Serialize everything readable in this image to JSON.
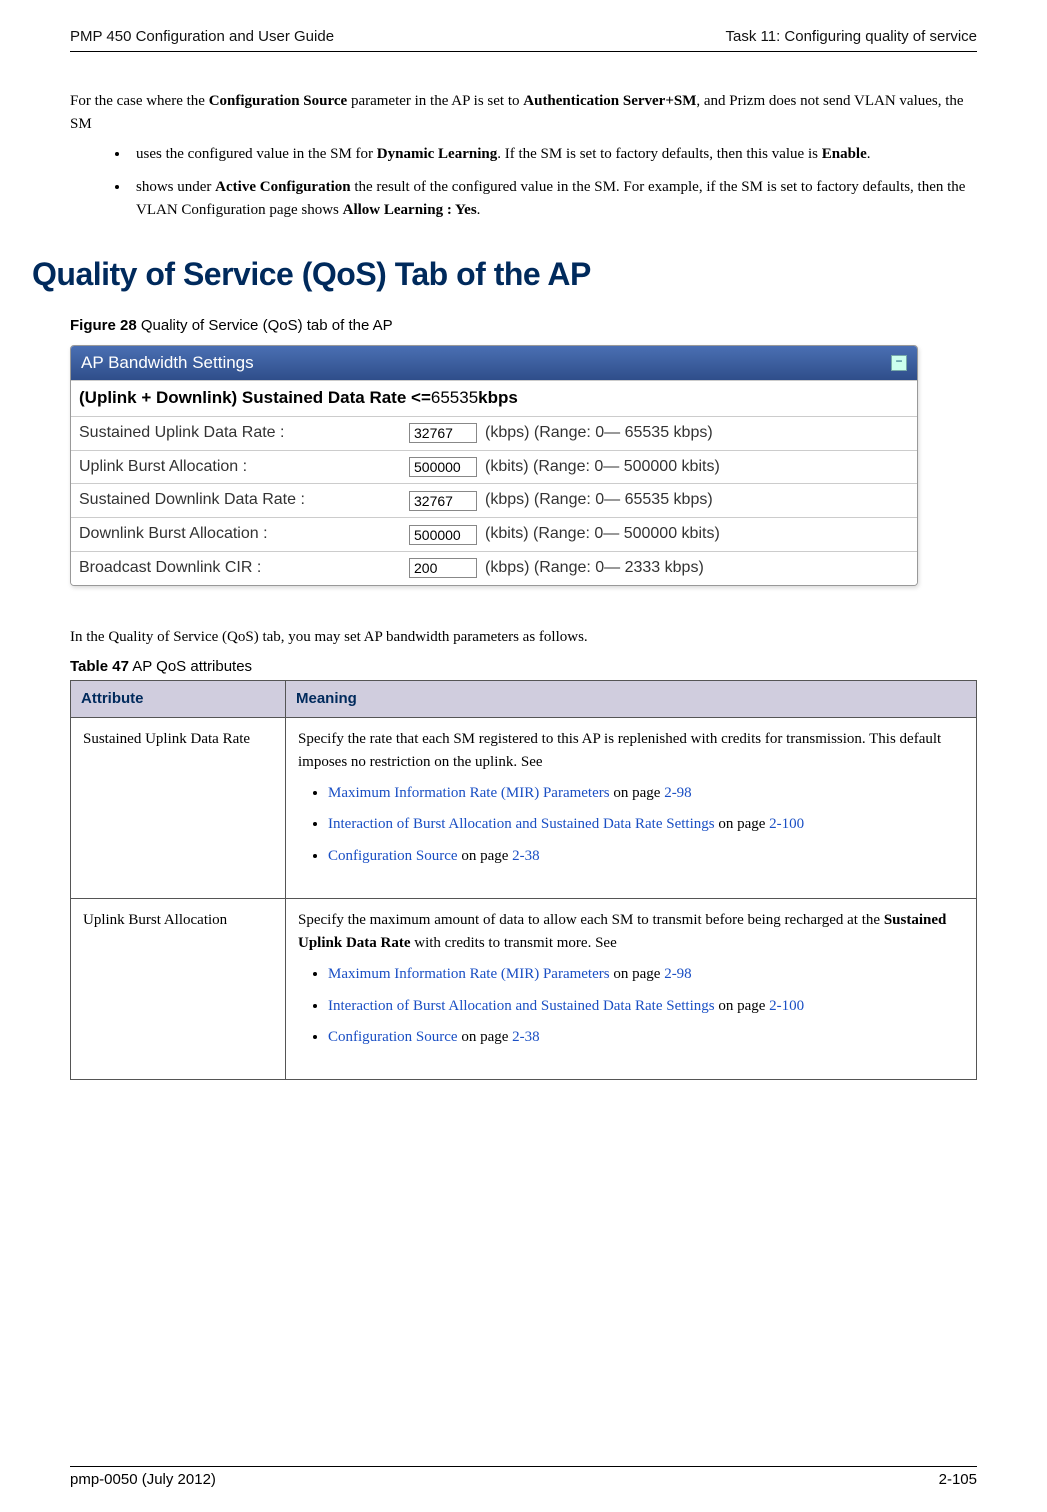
{
  "header": {
    "left": "PMP 450 Configuration and User Guide",
    "right": "Task 11: Configuring quality of service"
  },
  "intro": {
    "p1_pre": "For the case where the ",
    "p1_b1": "Configuration Source",
    "p1_mid": " parameter in the AP is set to ",
    "p1_b2": "Authentication Server+SM",
    "p1_post": ", and Prizm does not send VLAN values, the SM"
  },
  "bullets": {
    "b1_pre": "uses the configured value in the SM for ",
    "b1_bold": "Dynamic Learning",
    "b1_mid": ". If the SM is set to factory defaults, then this value is ",
    "b1_bold2": "Enable",
    "b1_end": ".",
    "b2_pre": "shows under ",
    "b2_bold": "Active Configuration",
    "b2_mid": " the result of the configured value in the SM. For example, if the SM is set to factory defaults, then the VLAN Configuration page shows ",
    "b2_bold2": "Allow Learning : Yes",
    "b2_end": "."
  },
  "section_title": "Quality of Service (QoS) Tab of the AP",
  "figure": {
    "num": "Figure 28",
    "caption": "  Quality of Service (QoS) tab of the AP"
  },
  "panel": {
    "title": "AP Bandwidth Settings",
    "sub_label": "(Uplink + Downlink) Sustained Data Rate <= ",
    "sub_value": "65535",
    "sub_unit": " kbps",
    "rows": [
      {
        "label": "Sustained Uplink Data Rate :",
        "value": "32767",
        "hint": "(kbps) (Range: 0— 65535 kbps)"
      },
      {
        "label": "Uplink Burst Allocation :",
        "value": "500000",
        "hint": "(kbits) (Range: 0— 500000 kbits)"
      },
      {
        "label": "Sustained Downlink Data Rate :",
        "value": "32767",
        "hint": "(kbps) (Range: 0— 65535 kbps)"
      },
      {
        "label": "Downlink Burst Allocation :",
        "value": "500000",
        "hint": "(kbits) (Range: 0— 500000 kbits)"
      },
      {
        "label": "Broadcast Downlink CIR :",
        "value": "200",
        "hint": "(kbps) (Range: 0— 2333 kbps)"
      }
    ]
  },
  "para_after": "In the Quality of Service (QoS) tab, you may set AP bandwidth parameters as follows.",
  "table_label": {
    "num": "Table 47",
    "caption": "  AP QoS attributes"
  },
  "table": {
    "h1": "Attribute",
    "h2": "Meaning",
    "rows": [
      {
        "attr": "Sustained Uplink Data Rate",
        "desc": "Specify the rate that each SM registered to this AP is replenished with credits for transmission. This default imposes no restriction on the uplink. See",
        "links": [
          {
            "text": "Maximum Information Rate (MIR) Parameters",
            "post": " on page ",
            "page": "2-98"
          },
          {
            "text": "Interaction of Burst Allocation and Sustained Data Rate Settings",
            "post": " on page ",
            "page": "2-100"
          },
          {
            "text": "Configuration Source",
            "post": " on page ",
            "page": "2-38"
          }
        ]
      },
      {
        "attr": "Uplink Burst Allocation",
        "desc_pre": "Specify the maximum amount of data to allow each SM to transmit before being recharged at the ",
        "desc_bold": "Sustained Uplink Data Rate",
        "desc_post": " with credits to transmit more. See",
        "links": [
          {
            "text": "Maximum Information Rate (MIR) Parameters",
            "post": " on page ",
            "page": "2-98"
          },
          {
            "text": "Interaction of Burst Allocation and Sustained Data Rate Settings",
            "post": " on page ",
            "page": "2-100"
          },
          {
            "text": "Configuration Source",
            "post": " on page ",
            "page": "2-38"
          }
        ]
      }
    ]
  },
  "footer": {
    "left": "pmp-0050 (July 2012)",
    "right": "2-105"
  }
}
